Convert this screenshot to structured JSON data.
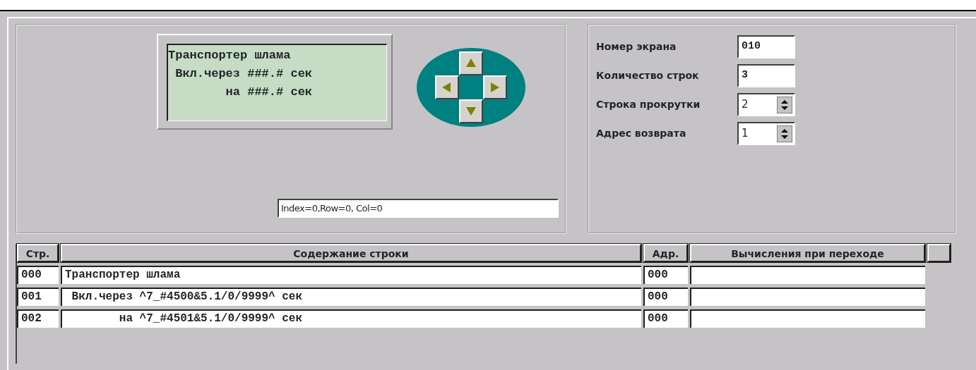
{
  "lcd": {
    "lines": [
      "Транспортер шлама",
      " Вкл.через ###.# сек",
      "        на ###.# сек"
    ]
  },
  "dpad": {
    "buttons": [
      {
        "kind": "up"
      },
      {
        "kind": "left"
      },
      {
        "kind": "right"
      },
      {
        "kind": "down"
      }
    ]
  },
  "status_field": {
    "value": "Index=0,Row=0, Col=0"
  },
  "settings": [
    {
      "label": "Номер экрана",
      "value": "010",
      "kind": "text"
    },
    {
      "label": "Количество строк",
      "value": "3",
      "kind": "text"
    },
    {
      "label": "Строка прокрутки",
      "value": "2",
      "kind": "spin"
    },
    {
      "label": "Адрес возврата",
      "value": "1",
      "kind": "spin"
    }
  ],
  "table": {
    "columns": [
      "Стр.",
      "Содержание строки",
      "Адр.",
      "Вычисления  при переходе"
    ],
    "rows": [
      {
        "num": "000",
        "content": "Транспортер шлама",
        "addr": "000"
      },
      {
        "num": "001",
        "content": " Вкл.через ^7_#4500&5.1/0/9999^ сек",
        "addr": "000"
      },
      {
        "num": "002",
        "content": "        на ^7_#4501&5.1/0/9999^ сек",
        "addr": "000"
      }
    ]
  }
}
